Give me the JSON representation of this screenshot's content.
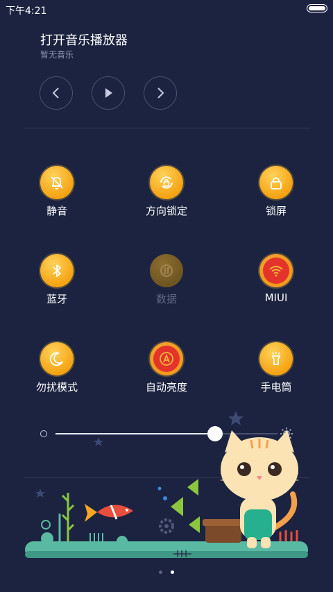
{
  "status": {
    "time": "下午4:21"
  },
  "music": {
    "title": "打开音乐播放器",
    "subtitle": "暂无音乐",
    "controls": [
      "chevron-left-icon",
      "play-icon",
      "chevron-right-icon"
    ]
  },
  "toggles": [
    {
      "label": "静音",
      "icon": "bell-off-icon",
      "state": "on"
    },
    {
      "label": "方向锁定",
      "icon": "rotation-lock-icon",
      "state": "on"
    },
    {
      "label": "锁屏",
      "icon": "lock-icon",
      "state": "on"
    },
    {
      "label": "蓝牙",
      "icon": "bluetooth-icon",
      "state": "on"
    },
    {
      "label": "数据",
      "icon": "data-icon",
      "state": "disabled"
    },
    {
      "label": "MIUI",
      "icon": "wifi-icon",
      "state": "active"
    },
    {
      "label": "勿扰模式",
      "icon": "moon-icon",
      "state": "on"
    },
    {
      "label": "自动亮度",
      "icon": "auto-brightness-icon",
      "state": "active"
    },
    {
      "label": "手电筒",
      "icon": "flashlight-icon",
      "state": "on"
    }
  ],
  "brightness": {
    "level": 0.72
  },
  "pager": {
    "pages": 2,
    "current": 2
  },
  "colors": {
    "background": "#1b2340",
    "accent": "#f5a313",
    "active": "#e3332b"
  }
}
